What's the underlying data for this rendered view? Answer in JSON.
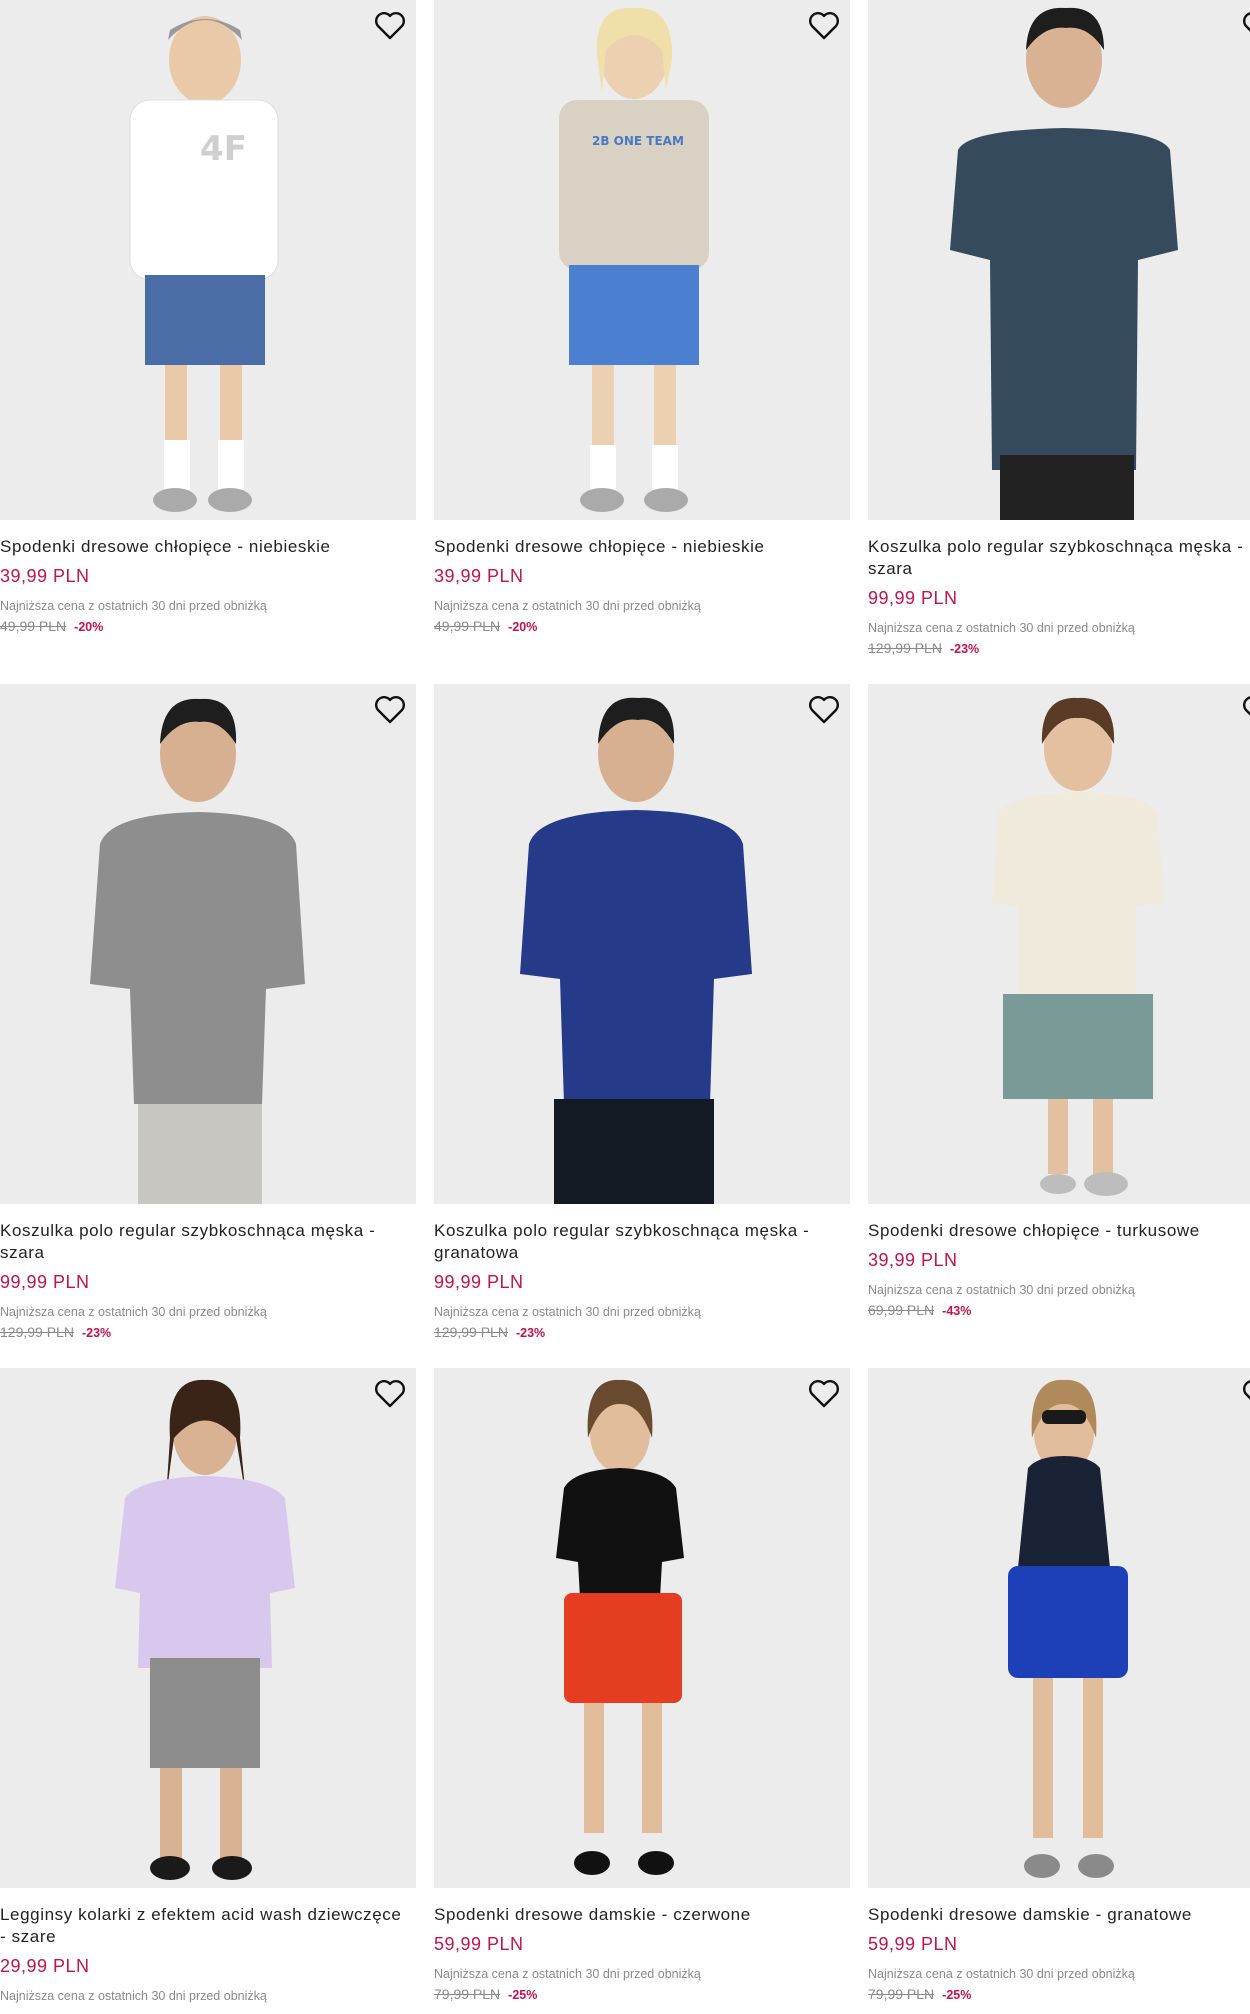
{
  "colors": {
    "price": "#c4124f",
    "photo_bg": "#ebebeb",
    "muted": "#8a8a8a"
  },
  "products": [
    {
      "title": "Spodenki dresowe chłopięce - niebieskie",
      "price": "39,99 PLN",
      "lowest_label": "Najniższa cena z ostatnich 30 dni przed obniżką",
      "old_price": "49,99 PLN",
      "discount": "-20%",
      "wishlist_icon": "heart-outline-icon"
    },
    {
      "title": "Spodenki dresowe chłopięce - niebieskie",
      "price": "39,99 PLN",
      "lowest_label": "Najniższa cena z ostatnich 30 dni przed obniżką",
      "old_price": "49,99 PLN",
      "discount": "-20%",
      "wishlist_icon": "heart-outline-icon"
    },
    {
      "title": "Koszulka polo regular szybkoschnąca męska - szara",
      "price": "99,99 PLN",
      "lowest_label": "Najniższa cena z ostatnich 30 dni przed obniżką",
      "old_price": "129,99 PLN",
      "discount": "-23%",
      "wishlist_icon": "heart-outline-icon"
    },
    {
      "title": "Koszulka polo regular szybkoschnąca męska - szara",
      "price": "99,99 PLN",
      "lowest_label": "Najniższa cena z ostatnich 30 dni przed obniżką",
      "old_price": "129,99 PLN",
      "discount": "-23%",
      "wishlist_icon": "heart-outline-icon"
    },
    {
      "title": "Koszulka polo regular szybkoschnąca męska - granatowa",
      "price": "99,99 PLN",
      "lowest_label": "Najniższa cena z ostatnich 30 dni przed obniżką",
      "old_price": "129,99 PLN",
      "discount": "-23%",
      "wishlist_icon": "heart-outline-icon"
    },
    {
      "title": "Spodenki dresowe chłopięce - turkusowe",
      "price": "39,99 PLN",
      "lowest_label": "Najniższa cena z ostatnich 30 dni przed obniżką",
      "old_price": "69,99 PLN",
      "discount": "-43%",
      "wishlist_icon": "heart-outline-icon"
    },
    {
      "title": "Legginsy kolarki z efektem acid wash dziewczęce - szare",
      "price": "29,99 PLN",
      "lowest_label": "Najniższa cena z ostatnich 30 dni przed obniżką",
      "old_price": "",
      "discount": "",
      "wishlist_icon": "heart-outline-icon"
    },
    {
      "title": "Spodenki dresowe damskie - czerwone",
      "price": "59,99 PLN",
      "lowest_label": "Najniższa cena z ostatnich 30 dni przed obniżką",
      "old_price": "79,99 PLN",
      "discount": "-25%",
      "wishlist_icon": "heart-outline-icon"
    },
    {
      "title": "Spodenki dresowe damskie - granatowe",
      "price": "59,99 PLN",
      "lowest_label": "Najniższa cena z ostatnich 30 dni przed obniżką",
      "old_price": "79,99 PLN",
      "discount": "-25%",
      "wishlist_icon": "heart-outline-icon"
    }
  ]
}
